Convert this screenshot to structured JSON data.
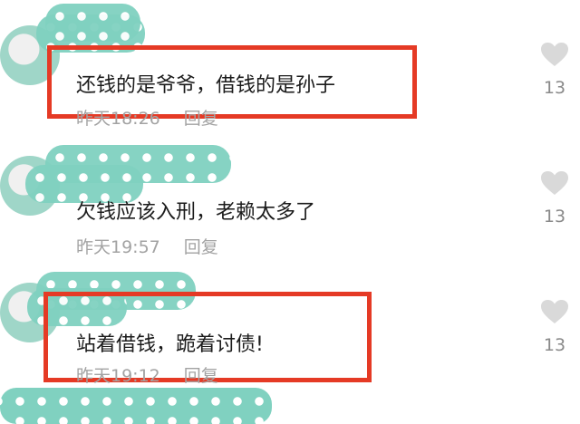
{
  "comments": [
    {
      "text": "还钱的是爷爷，借钱的是孙子",
      "time": "昨天18:26",
      "reply": "回复",
      "likes": "13"
    },
    {
      "text": "欠钱应该入刑，老赖太多了",
      "time": "昨天19:57",
      "reply": "回复",
      "likes": "13"
    },
    {
      "text": "站着借钱，跪着讨债!",
      "time": "昨天19:12",
      "reply": "回复",
      "likes": "13"
    }
  ],
  "colors": {
    "highlight": "#e53a25",
    "mask": "#80d1c0",
    "meta": "#a3a3a3"
  },
  "icons": {
    "like": "heart-icon"
  }
}
